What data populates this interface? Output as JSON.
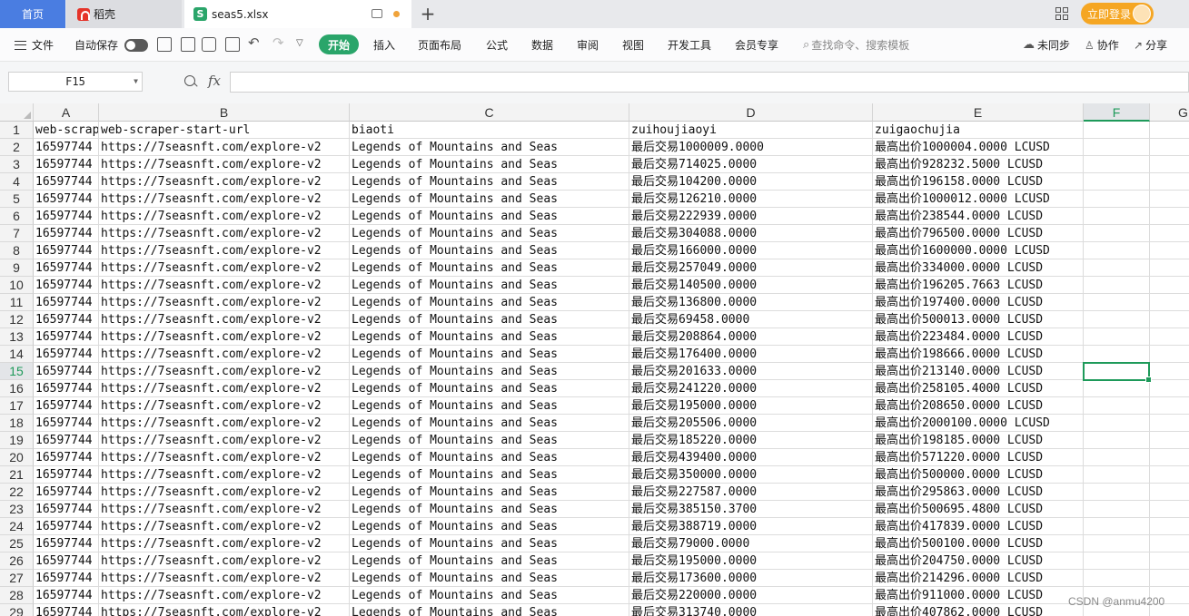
{
  "tabs": {
    "home": "首页",
    "dao": "稻壳",
    "file": "seas5.xlsx",
    "login": "立即登录"
  },
  "menu": {
    "file": "文件",
    "autosave": "自动保存",
    "start": "开始",
    "insert": "插入",
    "layout": "页面布局",
    "formula": "公式",
    "data": "数据",
    "review": "审阅",
    "view": "视图",
    "dev": "开发工具",
    "vip": "会员专享",
    "search": "查找命令、搜索模板",
    "sync": "未同步",
    "collab": "协作",
    "share": "分享"
  },
  "formula_bar": {
    "name_box": "F15",
    "fx": "fx",
    "value": ""
  },
  "sheet": {
    "columns": [
      "A",
      "B",
      "C",
      "D",
      "E",
      "F",
      "G"
    ],
    "active_column": "F",
    "active_row": 15,
    "header_row": [
      "web-scraper-order",
      "web-scraper-start-url",
      "biaoti",
      "zuihoujiaoyi",
      "zuigaochujia"
    ],
    "col_a_value": "16597744",
    "col_b_value": "https://7seasnft.com/explore-v2",
    "col_c_value": "Legends of Mountains and Seas",
    "rows": [
      [
        "最后交易1000009.0000",
        "最高出价1000004.0000 LCUSD"
      ],
      [
        "最后交易714025.0000",
        "最高出价928232.5000 LCUSD"
      ],
      [
        "最后交易104200.0000",
        "最高出价196158.0000 LCUSD"
      ],
      [
        "最后交易126210.0000",
        "最高出价1000012.0000 LCUSD"
      ],
      [
        "最后交易222939.0000",
        "最高出价238544.0000 LCUSD"
      ],
      [
        "最后交易304088.0000",
        "最高出价796500.0000 LCUSD"
      ],
      [
        "最后交易166000.0000",
        "最高出价1600000.0000 LCUSD"
      ],
      [
        "最后交易257049.0000",
        "最高出价334000.0000 LCUSD"
      ],
      [
        "最后交易140500.0000",
        "最高出价196205.7663 LCUSD"
      ],
      [
        "最后交易136800.0000",
        "最高出价197400.0000 LCUSD"
      ],
      [
        "最后交易69458.0000",
        "最高出价500013.0000 LCUSD"
      ],
      [
        "最后交易208864.0000",
        "最高出价223484.0000 LCUSD"
      ],
      [
        "最后交易176400.0000",
        "最高出价198666.0000 LCUSD"
      ],
      [
        "最后交易201633.0000",
        "最高出价213140.0000 LCUSD"
      ],
      [
        "最后交易241220.0000",
        "最高出价258105.4000 LCUSD"
      ],
      [
        "最后交易195000.0000",
        "最高出价208650.0000 LCUSD"
      ],
      [
        "最后交易205506.0000",
        "最高出价2000100.0000 LCUSD"
      ],
      [
        "最后交易185220.0000",
        "最高出价198185.0000 LCUSD"
      ],
      [
        "最后交易439400.0000",
        "最高出价571220.0000 LCUSD"
      ],
      [
        "最后交易350000.0000",
        "最高出价500000.0000 LCUSD"
      ],
      [
        "最后交易227587.0000",
        "最高出价295863.0000 LCUSD"
      ],
      [
        "最后交易385150.3700",
        "最高出价500695.4800 LCUSD"
      ],
      [
        "最后交易388719.0000",
        "最高出价417839.0000 LCUSD"
      ],
      [
        "最后交易79000.0000",
        "最高出价500100.0000 LCUSD"
      ],
      [
        "最后交易195000.0000",
        "最高出价204750.0000 LCUSD"
      ],
      [
        "最后交易173600.0000",
        "最高出价214296.0000 LCUSD"
      ],
      [
        "最后交易220000.0000",
        "最高出价911000.0000 LCUSD"
      ],
      [
        "最后交易313740.0000",
        "最高出价407862.0000 LCUSD"
      ]
    ]
  },
  "watermark": "CSDN @anmu4200",
  "colors": {
    "accent_green": "#2aa56a",
    "home_tab": "#4a7de1",
    "login": "#f5a623"
  }
}
